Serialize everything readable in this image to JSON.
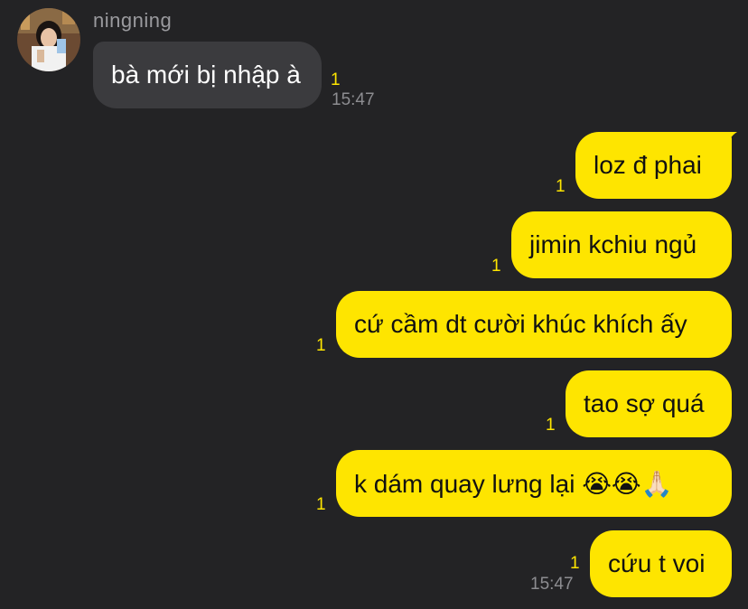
{
  "contact": {
    "name": "ningning",
    "avatar_icon": "profile-photo"
  },
  "incoming": [
    {
      "text": "bà mới bị nhập à",
      "read_count": "1",
      "time": "15:47"
    }
  ],
  "outgoing": [
    {
      "text": "loz đ phai",
      "read_count": "1"
    },
    {
      "text": "jimin kchiu ngủ",
      "read_count": "1"
    },
    {
      "text": "cứ cầm dt cười khúc khích ấy",
      "read_count": "1"
    },
    {
      "text": "tao sợ quá",
      "read_count": "1"
    },
    {
      "text": "k dám quay lưng lại 😭😭🙏🏻",
      "read_count": "1"
    },
    {
      "text": "cứu t voi",
      "read_count": "1",
      "time": "15:47"
    }
  ],
  "colors": {
    "background": "#232325",
    "incoming_bubble": "#3b3b3e",
    "outgoing_bubble": "#fee500",
    "read_indicator": "#fee500",
    "timestamp": "#8d8d91"
  }
}
